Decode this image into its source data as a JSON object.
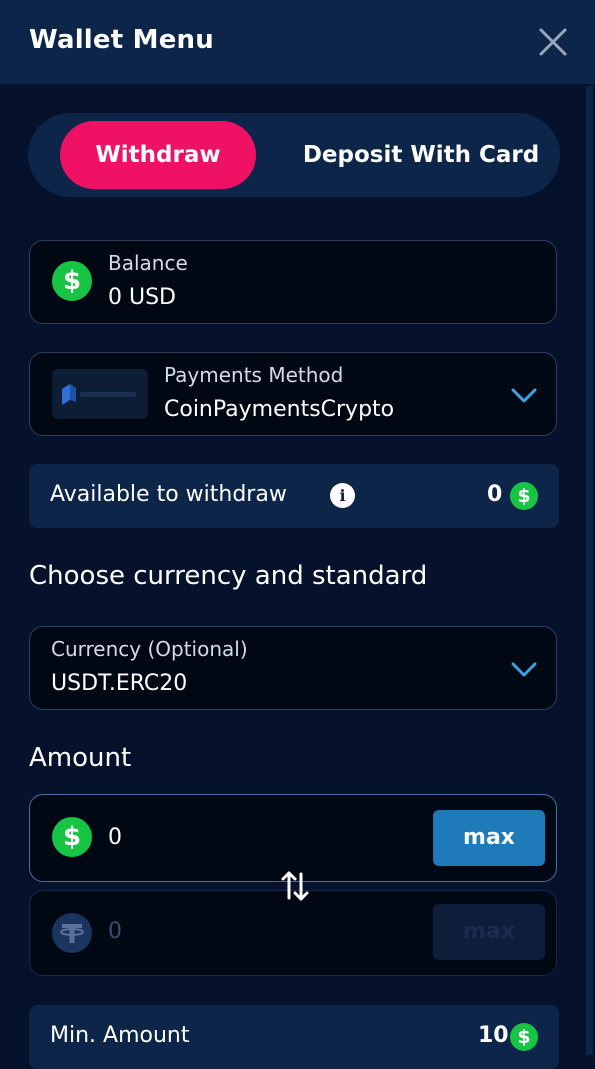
{
  "header": {
    "title": "Wallet Menu"
  },
  "tabs": [
    {
      "label": "Withdraw",
      "active": true
    },
    {
      "label": "Deposit With Card",
      "active": false
    }
  ],
  "balance": {
    "label": "Balance",
    "value": "0 USD",
    "icon": "dollar-coin-icon"
  },
  "payment_method": {
    "label": "Payments Method",
    "value": "CoinPaymentsCrypto",
    "logo": "coinpayments-logo"
  },
  "available": {
    "label": "Available to withdraw",
    "value": "0"
  },
  "choose_title": "Choose currency and standard",
  "currency": {
    "label": "Currency (Optional)",
    "value": "USDT.ERC20"
  },
  "amount": {
    "title": "Amount",
    "usd_value": "0",
    "crypto_value": "0",
    "max_label": "max",
    "max_label_disabled": "max"
  },
  "min_amount": {
    "label": "Min. Amount",
    "value": "10"
  },
  "colors": {
    "background": "#06122b",
    "panel": "#0c2548",
    "accent_pink": "#ee1164",
    "max_blue": "#1f7ab9",
    "coin_green": "#17c444",
    "chevron_blue": "#3ea3e0"
  }
}
